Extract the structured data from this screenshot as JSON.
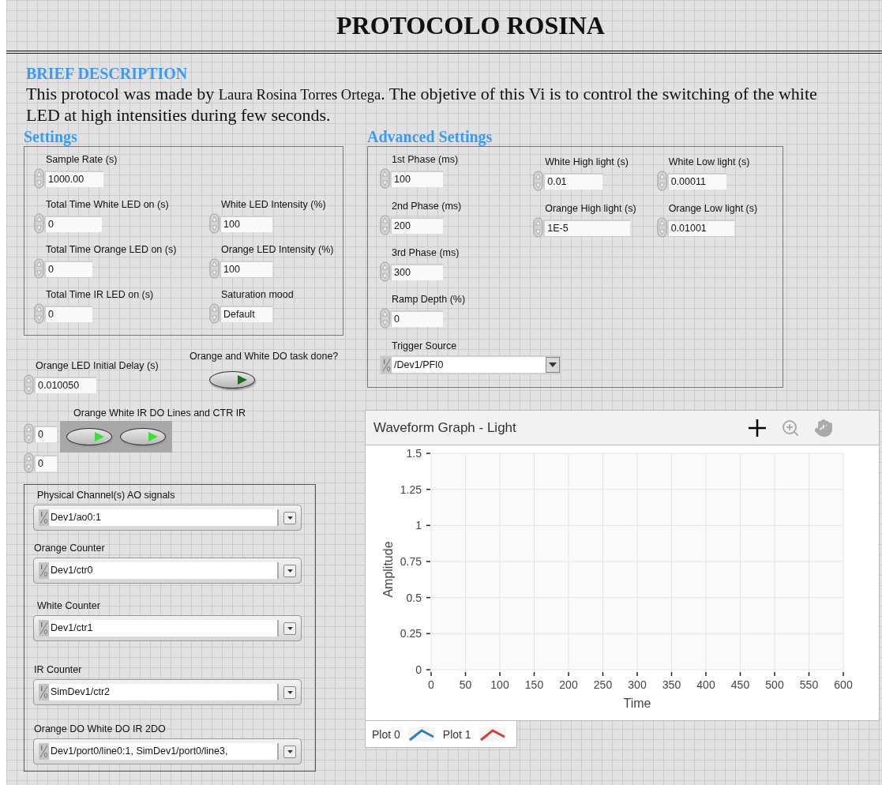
{
  "title": "PROTOCOLO ROSINA",
  "description": {
    "heading": "BRIEF DESCRIPTION",
    "intro": "This protocol was made by",
    "author": "Laura Rosina Torres Ortega",
    "rest": ". The objetive of this Vi is to control the switching of the white LED at high intensities during few seconds."
  },
  "settings": {
    "heading": "Settings",
    "rows": [
      [
        {
          "label": "Sample Rate (s)",
          "value": "1000.00"
        }
      ],
      [
        {
          "label": "Total Time White LED on (s)",
          "value": "0"
        },
        {
          "label": "White LED Intensity (%)",
          "value": "100"
        }
      ],
      [
        {
          "label": "Total Time Orange LED on (s)",
          "value": "0"
        },
        {
          "label": "Orange LED Intensity (%)",
          "value": "100"
        }
      ],
      [
        {
          "label": "Total Time IR LED on (s)",
          "value": "0"
        },
        {
          "label": "Saturation mood",
          "value": "Default"
        }
      ]
    ]
  },
  "delay": {
    "label": "Orange LED Initial Delay (s)",
    "value": "0.010050"
  },
  "task_done": {
    "label": "Orange and White DO task done?",
    "on": false
  },
  "do_lines": {
    "label": "Orange White IR DO Lines and CTR IR",
    "indices": [
      "0",
      "0"
    ],
    "buttons": [
      {
        "on": true
      },
      {
        "on": true
      }
    ]
  },
  "channels": [
    {
      "label": "Physical Channel(s) AO signals",
      "value": "Dev1/ao0:1"
    },
    {
      "label": "Orange Counter",
      "value": "Dev1/ctr0"
    },
    {
      "label": "White Counter",
      "value": "Dev1/ctr1"
    },
    {
      "label": "IR Counter",
      "value": "SimDev1/ctr2"
    },
    {
      "label": "Orange DO White DO IR 2DO",
      "value": "Dev1/port0/line0:1, SimDev1/port0/line3,"
    }
  ],
  "advanced": {
    "heading": "Advanced Settings",
    "columns": [
      [
        {
          "label": "1st Phase (ms)",
          "value": "100"
        },
        {
          "label": "2nd Phase (ms)",
          "value": "200"
        },
        {
          "label": "3rd Phase (ms)",
          "value": "300"
        },
        {
          "label": "Ramp Depth (%)",
          "value": "0"
        }
      ],
      [
        {
          "label": "White High light (s)",
          "value": "0.01"
        },
        {
          "label": "Orange High light (s)",
          "value": "1E-5"
        }
      ],
      [
        {
          "label": "White Low light (s)",
          "value": "0.00011"
        },
        {
          "label": "Orange Low light (s)",
          "value": "0.01001"
        }
      ]
    ],
    "trigger": {
      "label": "Trigger Source",
      "value": "/Dev1/PFI0"
    }
  },
  "graph": {
    "title": "Waveform Graph - Light",
    "chart_data": {
      "type": "line",
      "xlabel": "Time",
      "ylabel": "Amplitude",
      "ylim": [
        0,
        1.5
      ],
      "grid": true,
      "categories": [
        "0",
        "50",
        "100",
        "150",
        "200",
        "250",
        "300",
        "350",
        "400",
        "450",
        "500",
        "550",
        "600"
      ],
      "yticks": [
        0,
        0.25,
        0.5,
        0.75,
        1,
        1.25,
        1.5
      ],
      "series": [
        {
          "name": "Plot 0",
          "color": "#2e7fbf",
          "values": [
            null,
            null,
            null,
            null,
            null,
            null,
            null,
            null,
            null,
            null,
            null,
            null,
            null
          ]
        },
        {
          "name": "Plot 1",
          "color": "#cc4040",
          "values": [
            null,
            null,
            null,
            null,
            null,
            null,
            null,
            null,
            null,
            null,
            null,
            null,
            null
          ]
        }
      ]
    }
  }
}
